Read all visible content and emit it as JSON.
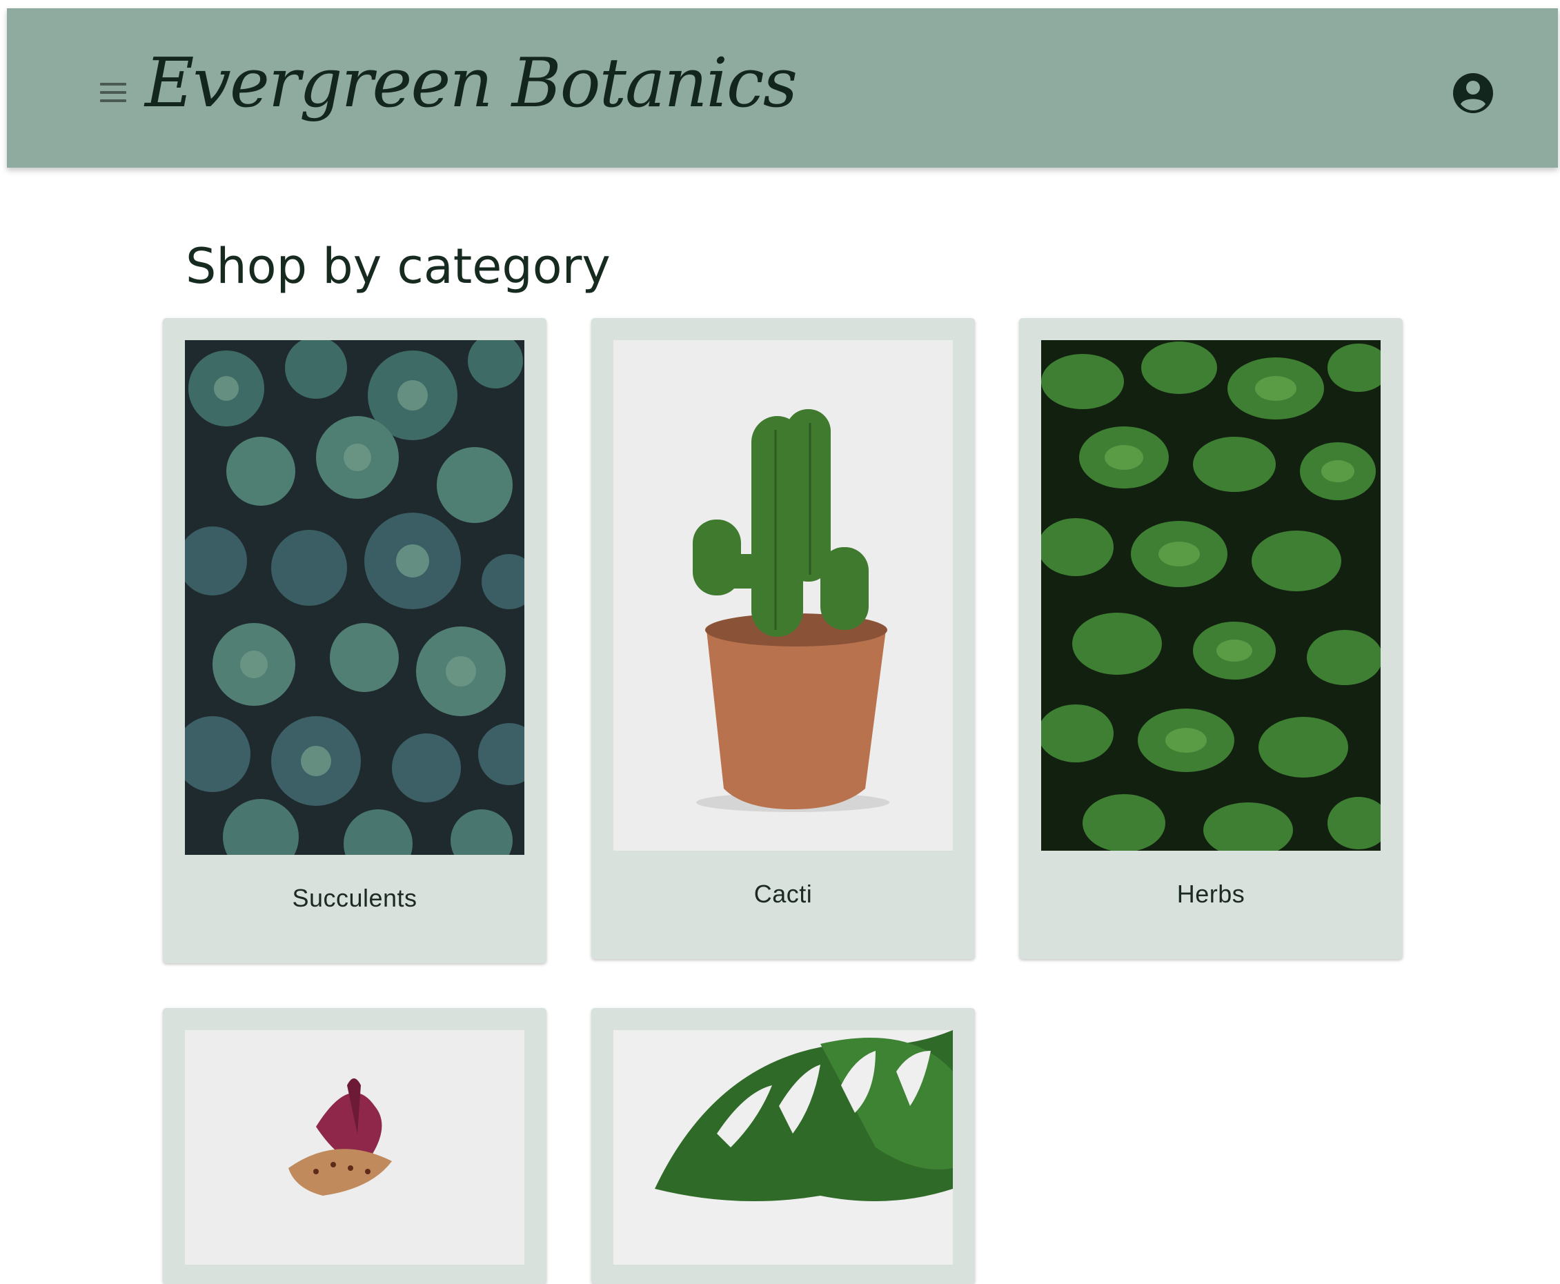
{
  "header": {
    "brand": "Evergreen Botanics",
    "menu_icon": "hamburger-menu-icon",
    "account_icon": "account-circle-icon",
    "background_color": "#8fab9f"
  },
  "main": {
    "section_title": "Shop by category",
    "categories": [
      {
        "label": "Succulents"
      },
      {
        "label": "Cacti"
      },
      {
        "label": "Herbs"
      },
      {
        "label": ""
      },
      {
        "label": ""
      }
    ]
  },
  "colors": {
    "card_background": "#d8e1dc",
    "text": "#172a20"
  }
}
